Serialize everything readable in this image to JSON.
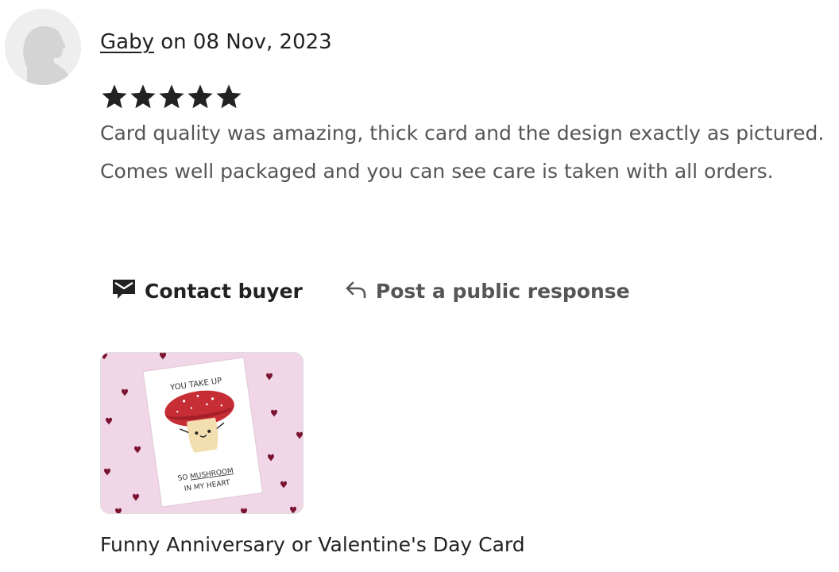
{
  "review": {
    "username": "Gaby",
    "date_text": " on 08 Nov, 2023",
    "rating": 5,
    "rating_max": 5,
    "text": "Card quality was amazing, thick card and the design exactly as pictured. Comes well packaged and you can see care is taken with all orders."
  },
  "actions": {
    "contact_label": "Contact buyer",
    "respond_label": "Post a public response"
  },
  "product": {
    "title": "Funny Anniversary or Valentine's Day Card",
    "card_text_top": "YOU TAKE UP",
    "card_text_line1_prefix": "SO ",
    "card_text_line1_underlined": "MUSHROOM",
    "card_text_line2": "IN MY HEART"
  },
  "colors": {
    "star": "#222222",
    "thumb_background": "#f0d6e6",
    "heart": "#7a1230",
    "mushroom_cap": "#c62d35"
  }
}
